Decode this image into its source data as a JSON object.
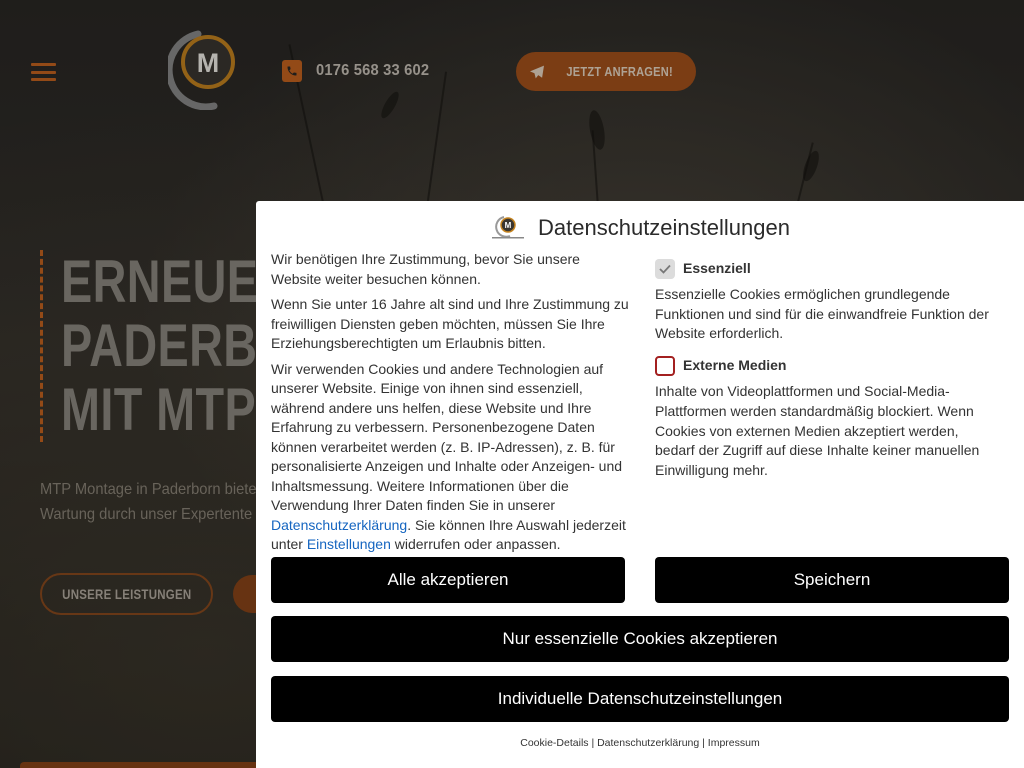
{
  "header": {
    "phone": "0176 568 33 602",
    "cta_label": "JETZT ANFRAGEN!",
    "logo_letter": "M"
  },
  "hero": {
    "headline_lines": [
      "ERNEUER",
      "PADERBO",
      "MIT MTP"
    ],
    "intro_lines": [
      "MTP Montage in Paderborn biete",
      "Wartung durch unser Expertente"
    ],
    "services_button": "UNSERE LEISTUNGEN"
  },
  "modal": {
    "title": "Datenschutzeinstellungen",
    "p1": "Wir benötigen Ihre Zustimmung, bevor Sie unsere Website weiter besuchen können.",
    "p2": "Wenn Sie unter 16 Jahre alt sind und Ihre Zustimmung zu freiwilligen Diensten geben möchten, müssen Sie Ihre Erziehungsberechtigten um Erlaubnis bitten.",
    "p3_before": "Wir verwenden Cookies und andere Technologien auf unserer Website. Einige von ihnen sind essenziell, während andere uns helfen, diese Website und Ihre Erfahrung zu verbessern. Personenbezogene Daten können verarbeitet werden (z. B. IP-Adressen), z. B. für personalisierte Anzeigen und Inhalte oder Anzeigen- und Inhaltsmessung. Weitere Informationen über die Verwendung Ihrer Daten finden Sie in unserer ",
    "p3_link1": "Datenschutzerklärung",
    "p3_middle": ". Sie können Ihre Auswahl jederzeit unter ",
    "p3_link2": "Einstellungen",
    "p3_after": " widerrufen oder anpassen.",
    "essential_label": "Essenziell",
    "essential_checked": true,
    "essential_desc": "Essenzielle Cookies ermöglichen grundlegende Funktionen und sind für die einwandfreie Funktion der Website erforderlich.",
    "external_label": "Externe Medien",
    "external_checked": false,
    "external_desc": "Inhalte von Videoplattformen und Social-Media-Plattformen werden standardmäßig blockiert. Wenn Cookies von externen Medien akzeptiert werden, bedarf der Zugriff auf diese Inhalte keiner manuellen Einwilligung mehr.",
    "btn_accept_all": "Alle akzeptieren",
    "btn_save": "Speichern",
    "btn_essential_only": "Nur essenzielle Cookies akzeptieren",
    "btn_individual": "Individuelle Datenschutzeinstellungen",
    "footer_cookie_details": "Cookie-Details",
    "footer_privacy": "Datenschutzerklärung",
    "footer_imprint": "Impressum",
    "footer_sep": " | "
  },
  "colors": {
    "accent": "#c4631f",
    "button_black": "#000000",
    "link": "#1565c0",
    "external_checkbox_border": "#a32020"
  },
  "icons": [
    "hamburger-menu-icon",
    "phone-icon",
    "paper-plane-icon",
    "checkmark-icon"
  ]
}
